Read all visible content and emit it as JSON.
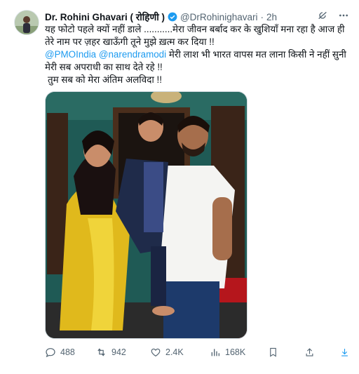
{
  "author": {
    "name": "Dr. Rohini Ghavari ( रोहिणी )",
    "handle": "@DrRohinighavari",
    "time": "2h",
    "dot": "·"
  },
  "text": {
    "line1": "यह फोटो पहले क्यों नहीं डाले ...........मेरा जीवन बर्बाद कर के खुशियाँ मना रहा है आज ही",
    "line2": "तेरे नाम पर ज़हर खाऊँगी तूने मुझे ख़त्म कर दिया !!",
    "mention1": "@PMOIndia",
    "mention2": "@narendramodi",
    "line3": "मेरी लाश भी भारत वापस मत लाना किसी ने नहीं सुनी",
    "line4": "मेरी सब अपराधी का साथ देते रहे !!",
    "line5": "तुम सब को मेरा अंतिम अलविदा !!"
  },
  "stats": {
    "replies": "488",
    "retweets": "942",
    "likes": "2.4K",
    "views": "168K"
  },
  "icons": {
    "verified": "verified-badge-icon",
    "grok": "grok-icon",
    "more": "more-icon",
    "reply": "reply-icon",
    "retweet": "retweet-icon",
    "like": "heart-icon",
    "views": "views-icon",
    "bookmark": "bookmark-icon",
    "share": "share-icon",
    "download": "download-icon"
  },
  "colors": {
    "link": "#1d9bf0",
    "muted": "#536471",
    "text": "#0f1419"
  }
}
